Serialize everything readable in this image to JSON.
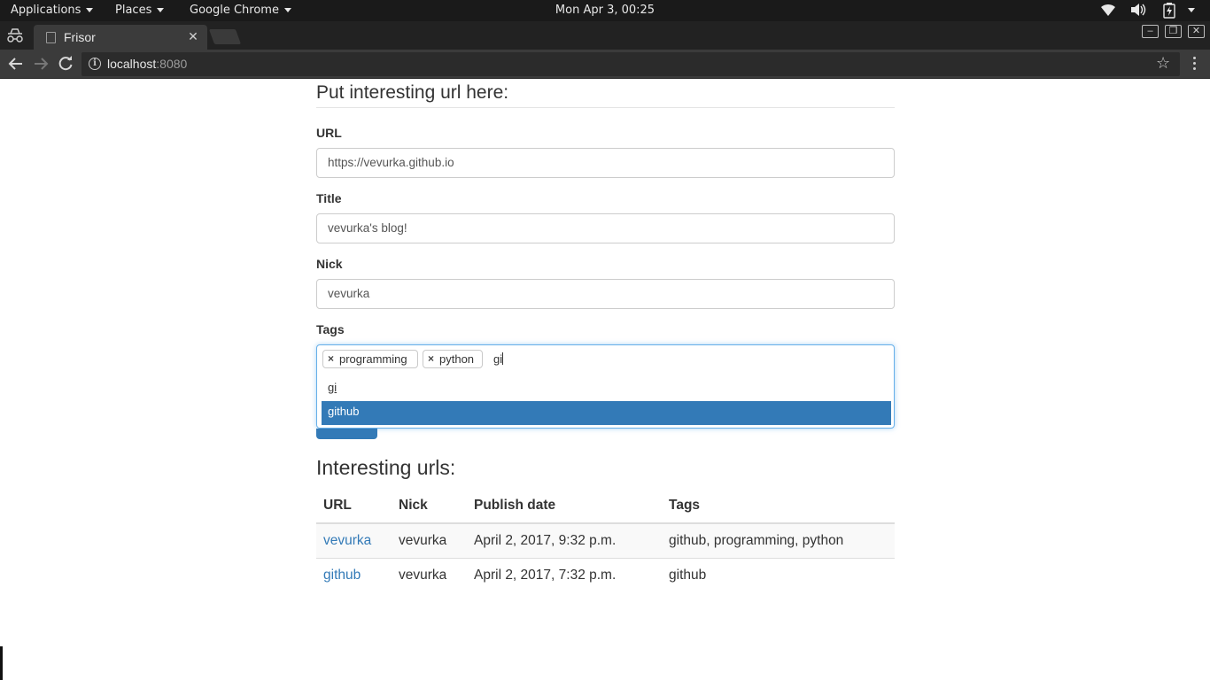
{
  "topbar": {
    "applications": "Applications",
    "places": "Places",
    "active_app": "Google Chrome",
    "clock": "Mon Apr  3, 00:25"
  },
  "browser": {
    "tab_title": "Frisor",
    "url_host": "localhost",
    "url_port": ":8080"
  },
  "form": {
    "heading": "Put interesting url here:",
    "url_label": "URL",
    "url_value": "https://vevurka.github.io",
    "title_label": "Title",
    "title_value": "vevurka's blog!",
    "nick_label": "Nick",
    "nick_value": "vevurka",
    "tags_label": "Tags",
    "tags": [
      "programming",
      "python"
    ],
    "tag_typed": "gi",
    "suggestions": [
      "gi",
      "github"
    ]
  },
  "list": {
    "heading": "Interesting urls:",
    "columns": [
      "URL",
      "Nick",
      "Publish date",
      "Tags"
    ],
    "rows": [
      {
        "url": "vevurka",
        "nick": "vevurka",
        "date": "April 2, 2017, 9:32 p.m.",
        "tags": "github, programming, python"
      },
      {
        "url": "github",
        "nick": "vevurka",
        "date": "April 2, 2017, 7:32 p.m.",
        "tags": "github"
      }
    ]
  },
  "colors": {
    "primary": "#337ab7",
    "focus": "#66afe9",
    "topbar": "#1a1a1a",
    "toolbar": "#3b3b3b"
  }
}
